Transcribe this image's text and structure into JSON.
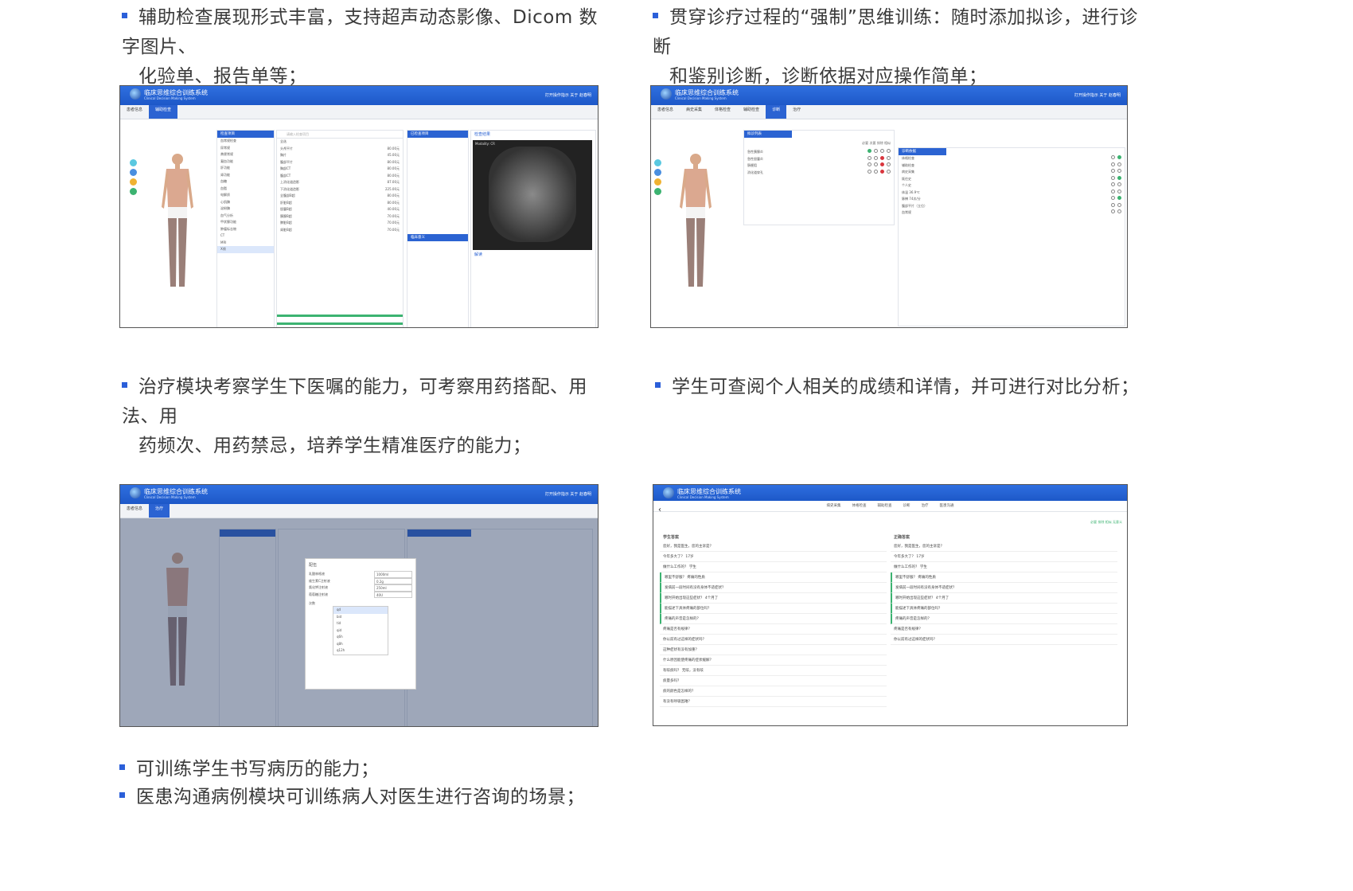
{
  "bullets": {
    "b1_line1": "辅助检查展现形式丰富，支持超声动态影像、Dicom 数字图片、",
    "b1_line2": "化验单、报告单等；",
    "b2_line1": "贯穿诊疗过程的“强制”思维训练：随时添加拟诊，进行诊断",
    "b2_line2": "和鉴别诊断，诊断依据对应操作简单；",
    "b3_line1": "治疗模块考察学生下医嘱的能力，可考察用药搭配、用法、用",
    "b3_line2": "药频次、用药禁忌，培养学生精准医疗的能力；",
    "b4_line1": "学生可查阅个人相关的成绩和详情，并可进行对比分析；",
    "b5_line1": "可训练学生书写病历的能力；",
    "b6_line1": "医患沟通病例模块可训练病人对医生进行咨询的场景；"
  },
  "app": {
    "title": "临床思维综合训练系统",
    "subtitle": "Clinical Decision Making System",
    "header_links": "打开操作指示    关于    赵春明",
    "tabs_aux": [
      "患者信息",
      "辅助检查"
    ],
    "tabs_diag": [
      "患者信息",
      "病史采集",
      "体格检查",
      "辅助检查",
      "诊断",
      "治疗"
    ],
    "tabs_treat": [
      "患者信息",
      "治疗"
    ],
    "tabs_score": [
      "病史采集",
      "体格检查",
      "辅助检查",
      "诊断",
      "治疗",
      "医患沟通"
    ]
  },
  "shot1": {
    "panel_left_title": "检查项目",
    "exam_items": [
      "血常规检查",
      "尿常规",
      "粪便常规",
      "凝血功能",
      "肝功能",
      "肾功能",
      "血糖",
      "血脂",
      "电解质",
      "心肌酶",
      "淀粉酶",
      "血气分析",
      "甲状腺功能",
      "肿瘤标志物",
      "CT",
      "MRI",
      "X线"
    ],
    "search_placeholder": "请输入检查项目",
    "options": [
      "全选",
      "头颅平片",
      "胸片",
      "腹部平片",
      "胸部CT",
      "腹部CT",
      "上消化道造影",
      "下消化道造影",
      "全腹部B超",
      "肝脏B超",
      "胆囊B超",
      "胰腺B超",
      "脾脏B超",
      "肾脏B超"
    ],
    "prices": [
      "80.00元",
      "45.00元",
      "80.00元",
      "80.00元",
      "80.00元",
      "87.00元",
      "225.00元",
      "80.00元",
      "80.00元",
      "40.00元",
      "70.00元",
      "70.00元",
      "70.00元",
      "100.00元"
    ],
    "done_title": "已检查项目",
    "result_title": "检查结果",
    "interp_title": "临床意义",
    "solve_title": "解读",
    "xray_label": "Modality: CR"
  },
  "shot2": {
    "pending_title": "拟诊列表",
    "diag_title": "诊断依据",
    "diagnoses": [
      "急性胰腺炎",
      "急性胆囊炎",
      "肠梗阻",
      "消化道穿孔"
    ],
    "evidence": [
      "体格检查",
      "辅助检查",
      "病史采集",
      "既往史",
      "个人史",
      "体温 36.9℃",
      "脉搏 74次/分",
      "腹部平片（立位）",
      "血常规"
    ],
    "col_labels": "必要  次要  排除  相似"
  },
  "shot3": {
    "modal_title": "配伍",
    "fields": [
      "乳酸林格液",
      "维生素C注射液",
      "氯化钾注射液",
      "葡萄糖注射液"
    ],
    "freq_label": "次数",
    "freq_options": [
      "qd",
      "bid",
      "tid",
      "qid",
      "q6h",
      "q8h",
      "q12h"
    ],
    "values": [
      "1000ml",
      "0.2g",
      "250ml",
      "40U"
    ]
  },
  "shot4": {
    "student_title": "学生答案",
    "correct_title": "正确答案",
    "lines": [
      "您好，我是医生，您的主诉是？",
      "今年多大了？ 17岁",
      "做什么工作的？ 学生",
      "哪里不舒服？ 疼痛的性质",
      "发病前一段时间有没有身体不适症状？",
      "哪时开始出现这些症状？ 4个月了",
      "能描述下具体疼痛的部位吗？",
      "疼痛的声音是怎样的？",
      "疼痛是否有规律？",
      "你以前有过这样的症状吗？",
      "这种症状有没有加重？",
      "什么原因能使疼痛的症状缓解？",
      "有咳痰吗？ 无咳，没有咳",
      "痰量多吗？",
      "痰的颜色是怎样的？",
      "有没有呼吸困难？"
    ],
    "legend": "必要  排除  相似  无意义"
  }
}
